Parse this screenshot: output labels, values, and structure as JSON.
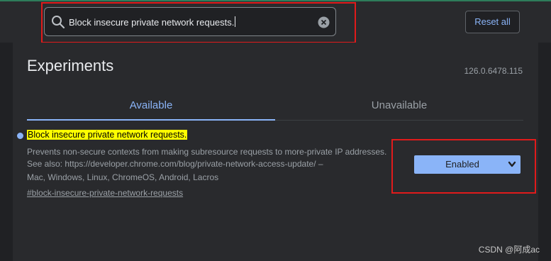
{
  "search": {
    "value": "Block insecure private network requests.",
    "icon": "search-icon",
    "clear_icon": "close-circle-icon"
  },
  "header": {
    "reset_label": "Reset all"
  },
  "page": {
    "title": "Experiments",
    "version": "126.0.6478.115"
  },
  "tabs": [
    {
      "label": "Available",
      "active": true
    },
    {
      "label": "Unavailable",
      "active": false
    }
  ],
  "experiment": {
    "name": "Block insecure private network requests.",
    "description": "Prevents non-secure contexts from making subresource requests to more-private IP addresses. See also: https://developer.chrome.com/blog/private-network-access-update/ –",
    "platforms": "Mac, Windows, Linux, ChromeOS, Android, Lacros",
    "link": "#block-insecure-private-network-requests",
    "selected_option": "Enabled"
  },
  "watermark": "CSDN @阿成ac",
  "colors": {
    "background": "#202124",
    "accent": "#8ab4f8",
    "highlight": "#ffff00",
    "annotation_red": "#e01b1b"
  }
}
